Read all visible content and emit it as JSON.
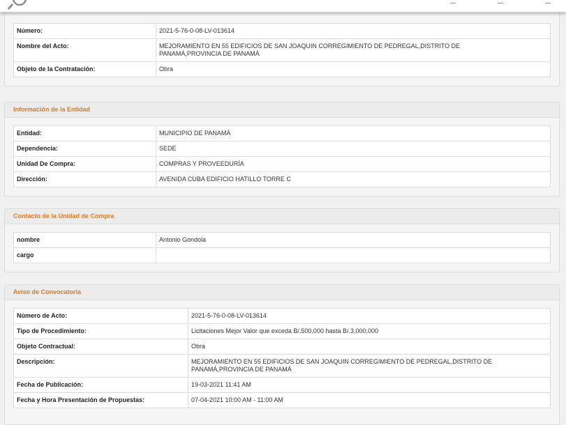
{
  "acto": {
    "rows": [
      {
        "label": "Número:",
        "value": "2021-5-76-0-08-LV-013614"
      },
      {
        "label": "Nombre del Acto:",
        "value": "MEJORAMIENTO EN 55 EDIFICIOS DE SAN JOAQUIN CORREGIMIENTO DE PEDREGAL,DISTRITO DE PANAMÁ,PROVINCIA DE PANAMÁ"
      },
      {
        "label": "Objeto de la Contratación:",
        "value": "Obra"
      }
    ]
  },
  "entidad": {
    "title": "Información de la Entidad",
    "rows": [
      {
        "label": "Entidad:",
        "value": "MUNICIPIO DE PANAMÁ"
      },
      {
        "label": "Dependencia:",
        "value": "SEDE"
      },
      {
        "label": "Unidad De Compra:",
        "value": "COMPRAS Y PROVEEDURÍA"
      },
      {
        "label": "Dirección:",
        "value": "AVENIDA CUBA EDIFICIO HATILLO TORRE C"
      }
    ]
  },
  "contacto": {
    "title": "Contacto de la Unidad de Compra",
    "rows": [
      {
        "label": "nombre",
        "value": "Antonio Gondola"
      },
      {
        "label": "cargo",
        "value": ""
      }
    ]
  },
  "aviso": {
    "title": "Aviso de Convocatoria",
    "rows": [
      {
        "label": "Número de Acto:",
        "value": "2021-5-76-0-08-LV-013614"
      },
      {
        "label": "Tipo de Procedimiento:",
        "value": "Licitaciones Mejor Valor que exceda B/.500,000 hasta B/.3,000,000"
      },
      {
        "label": "Objeto Contractual:",
        "value": "Obra"
      },
      {
        "label": "Descripción:",
        "value": "MEJORAMIENTO EN 55 EDIFICIOS DE SAN JOAQUIN CORREGIMIENTO DE PEDREGAL,DISTRITO DE PANAMÁ,PROVINCIA DE PANAMÁ"
      },
      {
        "label": "Fecha de Publicación:",
        "value": "19-03-2021 11:41 AM"
      },
      {
        "label": "Fecha y Hora Presentación de Propuestas:",
        "value": "07-04-2021 10:00 AM - 11:00 AM"
      }
    ]
  }
}
